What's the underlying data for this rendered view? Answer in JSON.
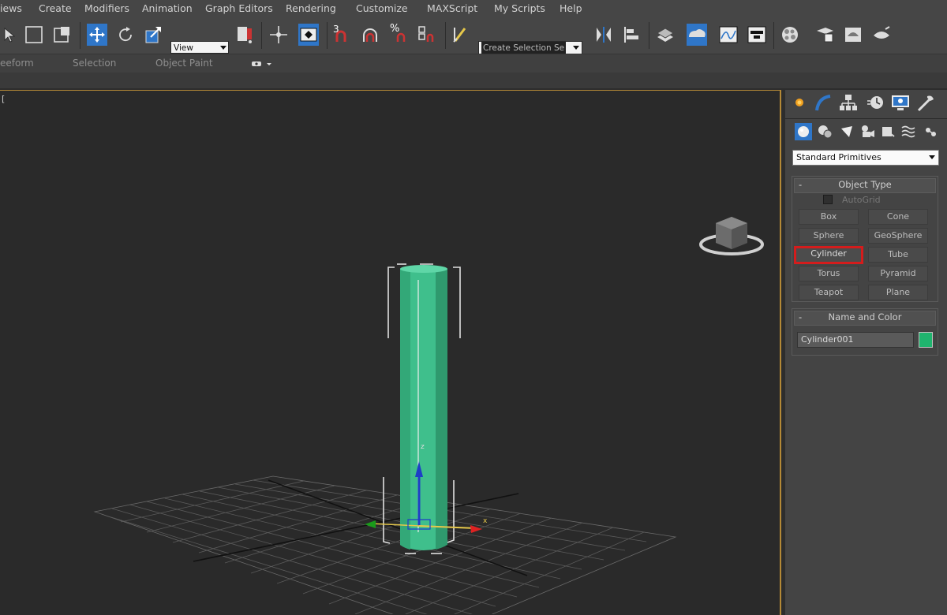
{
  "menu": [
    "iews",
    "Create",
    "Modifiers",
    "Animation",
    "Graph Editors",
    "Rendering",
    "Customize",
    "MAXScript",
    "My Scripts",
    "Help"
  ],
  "toolbar": {
    "view_dropdown": "View",
    "selection_set_placeholder": "Create Selection Se",
    "snaps_label": "3",
    "percent_snap_label": "%"
  },
  "ribbon": {
    "tabs": [
      "eeform",
      "Selection",
      "Object Paint"
    ]
  },
  "viewport": {
    "label": "[",
    "gizmo": {
      "z": "z",
      "x": "x"
    }
  },
  "command_panel": {
    "dropdown": "Standard Primitives",
    "object_type": {
      "title": "Object Type",
      "collapse": "-",
      "autogrid": "AutoGrid",
      "buttons": [
        "Box",
        "Cone",
        "Sphere",
        "GeoSphere",
        "Cylinder",
        "Tube",
        "Torus",
        "Pyramid",
        "Teapot",
        "Plane"
      ],
      "active_button": "Cylinder"
    },
    "name_and_color": {
      "title": "Name and Color",
      "collapse": "-",
      "name": "Cylinder001",
      "color": "#1fb46e"
    }
  },
  "colors": {
    "accent_blue": "#2f76c8",
    "viewport_border": "#b48936",
    "highlight_red": "#d41c1c",
    "cylinder": "#3fbf8c"
  }
}
